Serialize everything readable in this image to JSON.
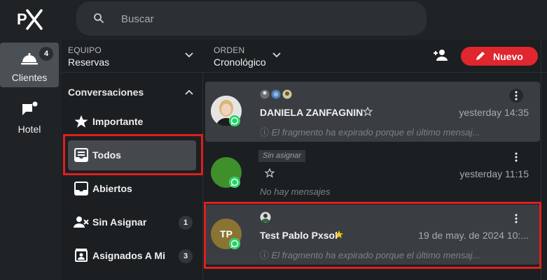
{
  "topbar": {
    "logo_text": "PX",
    "search_placeholder": "Buscar"
  },
  "rail": {
    "items": [
      {
        "label": "Clientes",
        "icon": "bell-service-icon",
        "badge": "4",
        "active": true
      },
      {
        "label": "Hotel",
        "icon": "chat-notification-icon",
        "active": false
      }
    ]
  },
  "filters": {
    "equipo": {
      "label": "EQUIPO",
      "value": "Reservas"
    },
    "orden": {
      "label": "ORDEN",
      "value": "Cronológico"
    },
    "new_button": "Nuevo",
    "accent": "#e0262e"
  },
  "panel": {
    "title": "Conversaciones",
    "items": [
      {
        "label": "Importante",
        "icon": "star-icon",
        "count": null,
        "active": false
      },
      {
        "label": "Todos",
        "icon": "inbox-list-icon",
        "count": null,
        "active": true
      },
      {
        "label": "Abiertos",
        "icon": "inbox-icon",
        "count": null,
        "active": false
      },
      {
        "label": "Sin Asignar",
        "icon": "user-remove-icon",
        "count": "1",
        "active": false
      },
      {
        "label": "Asignados A Mi",
        "icon": "contact-card-icon",
        "count": "3",
        "active": false
      }
    ]
  },
  "conversations": [
    {
      "name": "DANIELA ZANFAGNIN",
      "time": "yesterday 14:35",
      "preview": "El fragmento ha expirado porque el último mensaj...",
      "avatar_initials": "",
      "avatar_color": "#d8d8d8",
      "starred": false,
      "chip": ""
    },
    {
      "name": "",
      "time": "yesterday 11:15",
      "preview": "No hay mensajes",
      "avatar_initials": "",
      "avatar_color": "#3f8f2a",
      "starred": false,
      "chip": "Sin asignar"
    },
    {
      "name": "Test Pablo Pxsol",
      "time": "19 de may. de 2024 10:...",
      "preview": "El fragmento ha expirado porque el último mensaj...",
      "avatar_initials": "TP",
      "avatar_color": "#8a7434",
      "starred": true,
      "chip": ""
    }
  ],
  "colors": {
    "whatsapp": "#25d366",
    "star_gold": "#f5c518",
    "annotation_red": "#e01e1e"
  }
}
